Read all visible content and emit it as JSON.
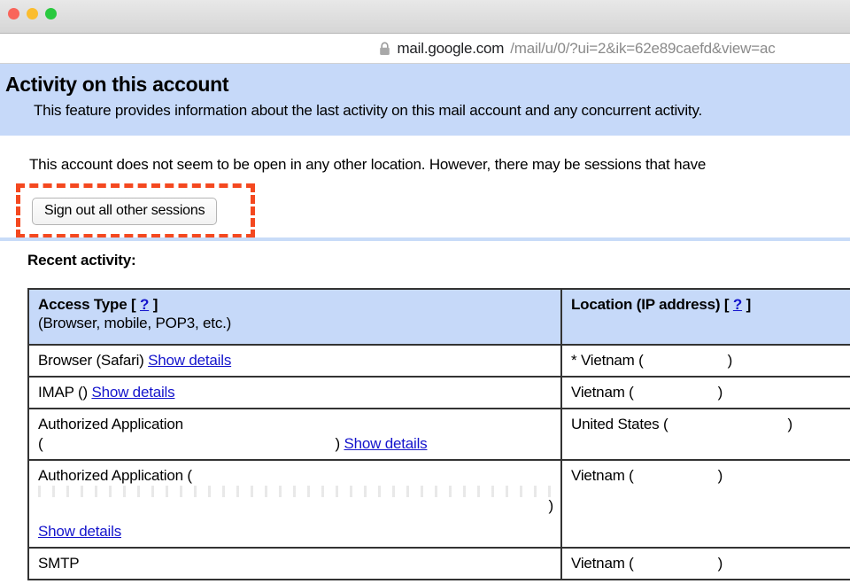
{
  "window": {
    "traffic_lights": [
      "close",
      "minimize",
      "zoom"
    ],
    "colors": {
      "close": "#f9655b",
      "minimize": "#fbbd2e",
      "zoom": "#29c93f",
      "banner_blue": "#c6d9f9",
      "annotation_red": "#f4481f",
      "link_blue": "#1414cc"
    }
  },
  "urlbar": {
    "lock_icon": "lock-icon",
    "domain": "mail.google.com",
    "path": "/mail/u/0/?ui=2&ik=62e89caefd&view=ac"
  },
  "banner": {
    "title": "Activity on this account",
    "subtitle": "This feature provides information about the last activity on this mail account and any concurrent activity."
  },
  "status": {
    "message": "This account does not seem to be open in any other location. However, there may be sessions that have"
  },
  "signout": {
    "button_label": "Sign out all other sessions",
    "annotation": "highlight-box"
  },
  "recent": {
    "heading": "Recent activity:"
  },
  "table": {
    "headers": [
      {
        "title": "Access Type [ ? ]",
        "title_text": "Access Type",
        "help": "?",
        "subtitle": "(Browser, mobile, POP3, etc.)"
      },
      {
        "title": "Location (IP address) [ ? ]",
        "title_text": "Location (IP address)",
        "help": "?"
      }
    ],
    "rows": [
      {
        "access_type": "Browser (Safari)",
        "show_details": "Show details",
        "layout": "inline",
        "location": "* Vietnam (",
        "location_close": ")",
        "ip": ""
      },
      {
        "access_type": "IMAP ()",
        "show_details": "Show details",
        "layout": "inline",
        "location": "Vietnam (",
        "location_close": ")",
        "ip": ""
      },
      {
        "access_type": "Authorized Application",
        "access_type_line2_open": "(",
        "access_type_line2_close": ")",
        "show_details": "Show details",
        "layout": "two-line",
        "location": "United States (",
        "location_close": ")",
        "ip": ""
      },
      {
        "access_type": "Authorized Application (",
        "access_type_close": ")",
        "show_details": "Show details",
        "layout": "tall-redacted",
        "location": "Vietnam (",
        "location_close": ")",
        "ip": ""
      },
      {
        "access_type": "SMTP",
        "show_details": "",
        "layout": "plain",
        "location": "Vietnam (",
        "location_close": ")",
        "ip": ""
      }
    ]
  }
}
